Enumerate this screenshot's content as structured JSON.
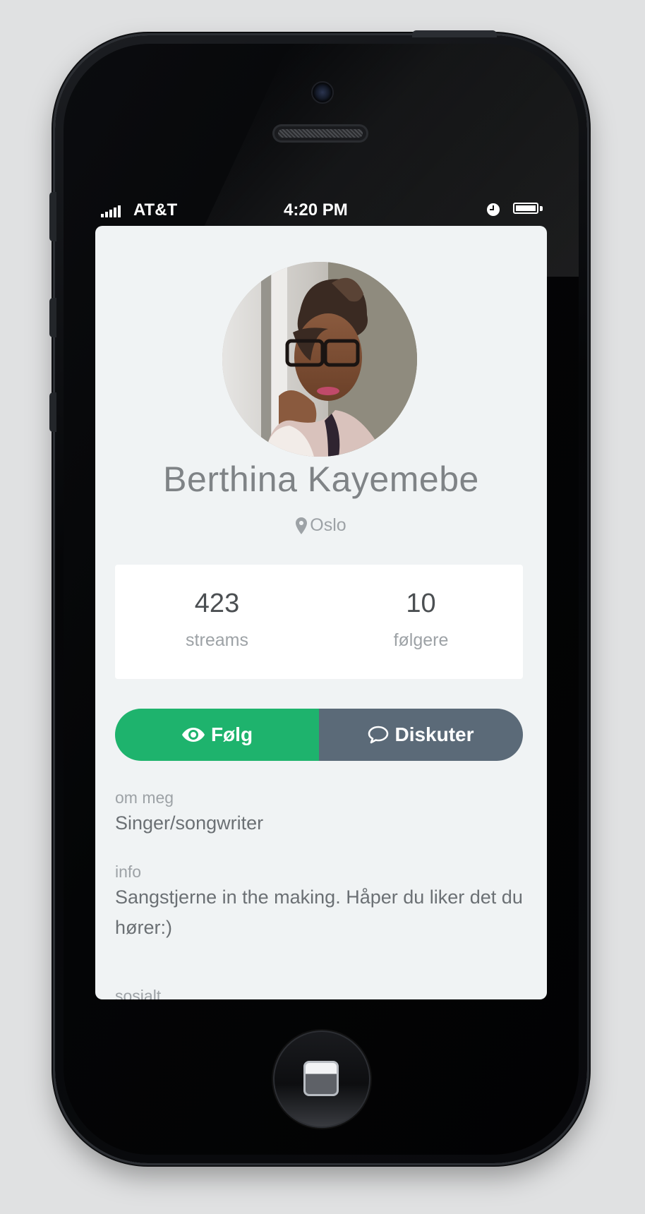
{
  "status_bar": {
    "carrier": "AT&T",
    "time": "4:20 PM",
    "signal_bars": 5
  },
  "profile": {
    "name": "Berthina Kayemebe",
    "location": "Oslo",
    "stats": [
      {
        "value": "423",
        "label": "streams"
      },
      {
        "value": "10",
        "label": "følgere"
      }
    ]
  },
  "actions": {
    "follow_label": "Følg",
    "discuss_label": "Diskuter"
  },
  "sections": {
    "about_label": "om meg",
    "about_text": "Singer/songwriter",
    "info_label": "info",
    "info_text": "Sangstjerne in the making. Håper du liker det du hører:)",
    "social_label": "sosialt"
  },
  "colors": {
    "follow": "#1eb36d",
    "discuss": "#5b6a78",
    "screen_bg": "#f0f3f4",
    "name_text": "#7f8386"
  },
  "icons": {
    "location": "map-pin-icon",
    "follow": "eye-icon",
    "discuss": "speech-bubble-icon"
  }
}
